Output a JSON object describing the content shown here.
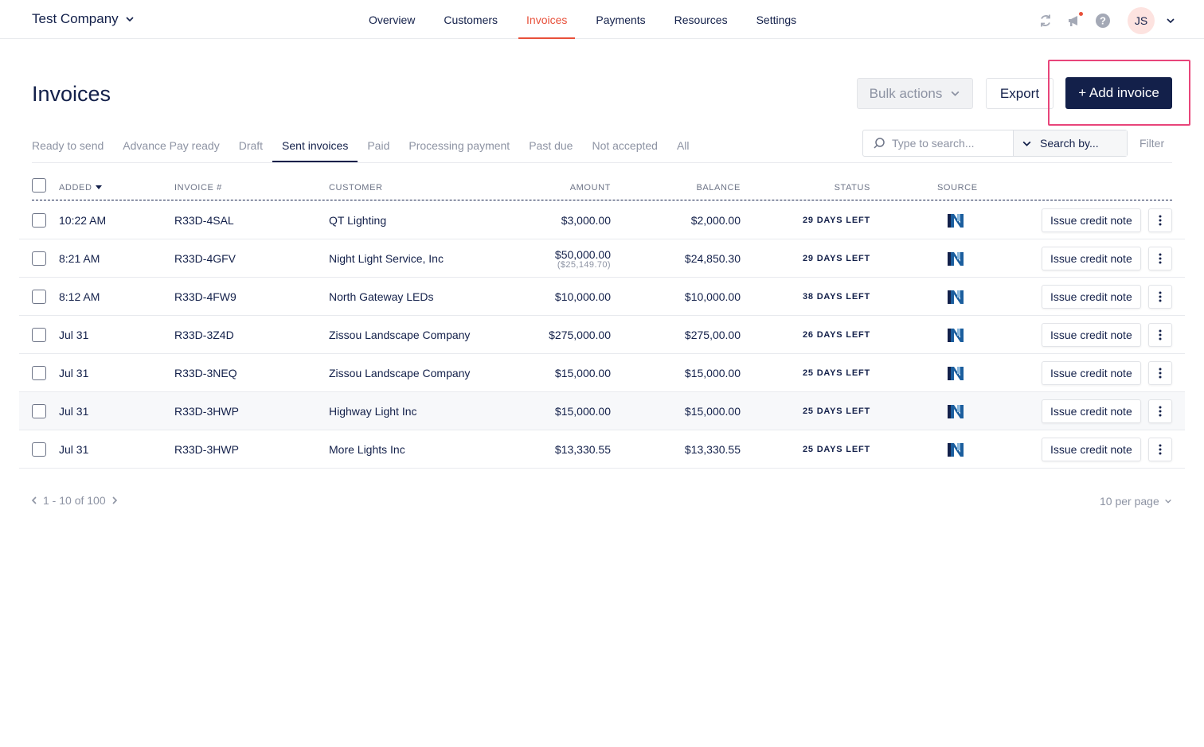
{
  "topbar": {
    "company": "Test Company",
    "nav": [
      "Overview",
      "Customers",
      "Invoices",
      "Payments",
      "Resources",
      "Settings"
    ],
    "active_nav": "Invoices",
    "avatar_initials": "JS"
  },
  "header": {
    "title": "Invoices",
    "bulk_actions_label": "Bulk actions",
    "export_label": "Export",
    "add_invoice_label": "+ Add invoice"
  },
  "tabs": {
    "items": [
      "Ready to send",
      "Advance Pay ready",
      "Draft",
      "Sent invoices",
      "Paid",
      "Processing payment",
      "Past due",
      "Not accepted",
      "All"
    ],
    "active": "Sent invoices"
  },
  "search": {
    "placeholder": "Type to search...",
    "search_by_label": "Search by...",
    "filter_label": "Filter"
  },
  "table": {
    "headers": {
      "added": "ADDED",
      "invoice": "INVOICE #",
      "customer": "CUSTOMER",
      "amount": "AMOUNT",
      "balance": "BALANCE",
      "status": "STATUS",
      "source": "SOURCE"
    },
    "action_label": "Issue credit note",
    "rows": [
      {
        "added": "10:22 AM",
        "invoice": "R33D-4SAL",
        "customer": "QT Lighting",
        "amount": "$3,000.00",
        "sub_amount": "",
        "balance": "$2,000.00",
        "status": "29 DAYS LEFT"
      },
      {
        "added": "8:21 AM",
        "invoice": "R33D-4GFV",
        "customer": "Night Light Service, Inc",
        "amount": "$50,000.00",
        "sub_amount": "($25,149.70)",
        "balance": "$24,850.30",
        "status": "29 DAYS LEFT"
      },
      {
        "added": "8:12 AM",
        "invoice": "R33D-4FW9",
        "customer": "North Gateway LEDs",
        "amount": "$10,000.00",
        "sub_amount": "",
        "balance": "$10,000.00",
        "status": "38 DAYS LEFT"
      },
      {
        "added": "Jul 31",
        "invoice": "R33D-3Z4D",
        "customer": "Zissou Landscape Company",
        "amount": "$275,000.00",
        "sub_amount": "",
        "balance": "$275,00.00",
        "status": "26 DAYS LEFT"
      },
      {
        "added": "Jul 31",
        "invoice": "R33D-3NEQ",
        "customer": "Zissou Landscape Company",
        "amount": "$15,000.00",
        "sub_amount": "",
        "balance": "$15,000.00",
        "status": "25 DAYS LEFT"
      },
      {
        "added": "Jul 31",
        "invoice": "R33D-3HWP",
        "customer": "Highway Light Inc",
        "amount": "$15,000.00",
        "sub_amount": "",
        "balance": "$15,000.00",
        "status": "25 DAYS LEFT"
      },
      {
        "added": "Jul 31",
        "invoice": "R33D-3HWP",
        "customer": "More Lights Inc",
        "amount": "$13,330.55",
        "sub_amount": "",
        "balance": "$13,330.55",
        "status": "25 DAYS LEFT"
      }
    ]
  },
  "pagination": {
    "range": "1 - 10 of 100",
    "per_page": "10 per page"
  },
  "colors": {
    "navy": "#13204a",
    "accent": "#e8503a",
    "highlight": "#e8457a",
    "muted": "#8d93a3"
  }
}
